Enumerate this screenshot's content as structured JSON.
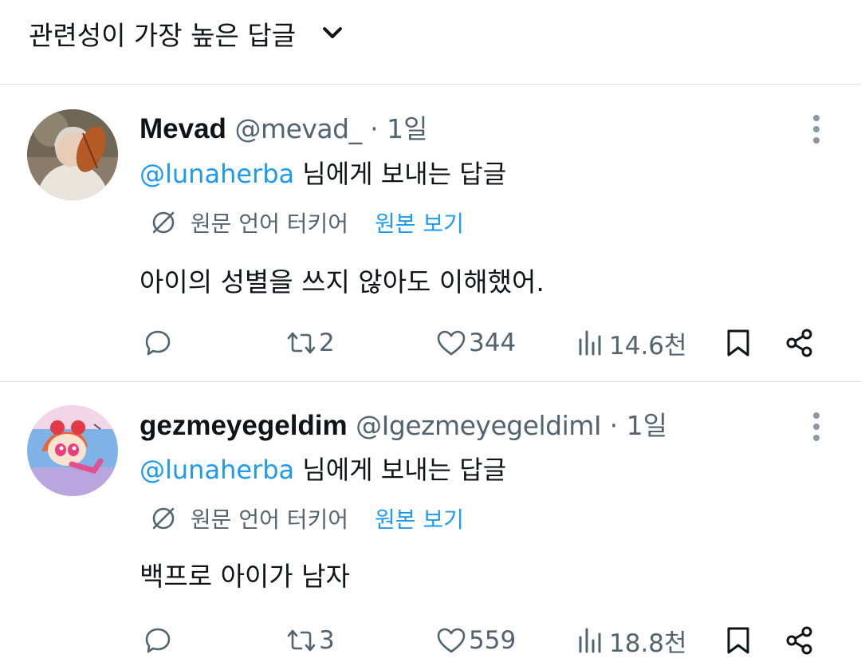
{
  "sort": {
    "label": "관련성이 가장 높은 답글"
  },
  "replies": [
    {
      "name": "Mevad",
      "handle": "@mevad_",
      "dot": "·",
      "time": "1일",
      "mention": "@lunaherba",
      "reply_suffix": " 님에게 보내는 답글",
      "translate_lang": "원문 언어 터키어",
      "translate_view": "원본 보기",
      "text": "아이의 성별을 쓰지 않아도 이해했어.",
      "retweets": "2",
      "likes": "344",
      "views": "14.6천"
    },
    {
      "name": "gezmeyegeldim",
      "handle": "@IgezmeyegeldimI",
      "dot": "·",
      "time": "1일",
      "mention": "@lunaherba",
      "reply_suffix": " 님에게 보내는 답글",
      "translate_lang": "원문 언어 터키어",
      "translate_view": "원본 보기",
      "text": "백프로 아이가 남자",
      "retweets": "3",
      "likes": "559",
      "views": "18.8천"
    }
  ],
  "icons": {
    "sort": "chevron-down-icon",
    "more": "more-vertical-icon",
    "translate": "translate-icon",
    "reply": "reply-icon",
    "retweet": "retweet-icon",
    "like": "heart-icon",
    "views": "views-icon",
    "bookmark": "bookmark-icon",
    "share": "share-icon"
  },
  "colors": {
    "link": "#1d9bf0",
    "secondary": "#536471",
    "text": "#0f1419",
    "divider": "#dcdfe3"
  }
}
